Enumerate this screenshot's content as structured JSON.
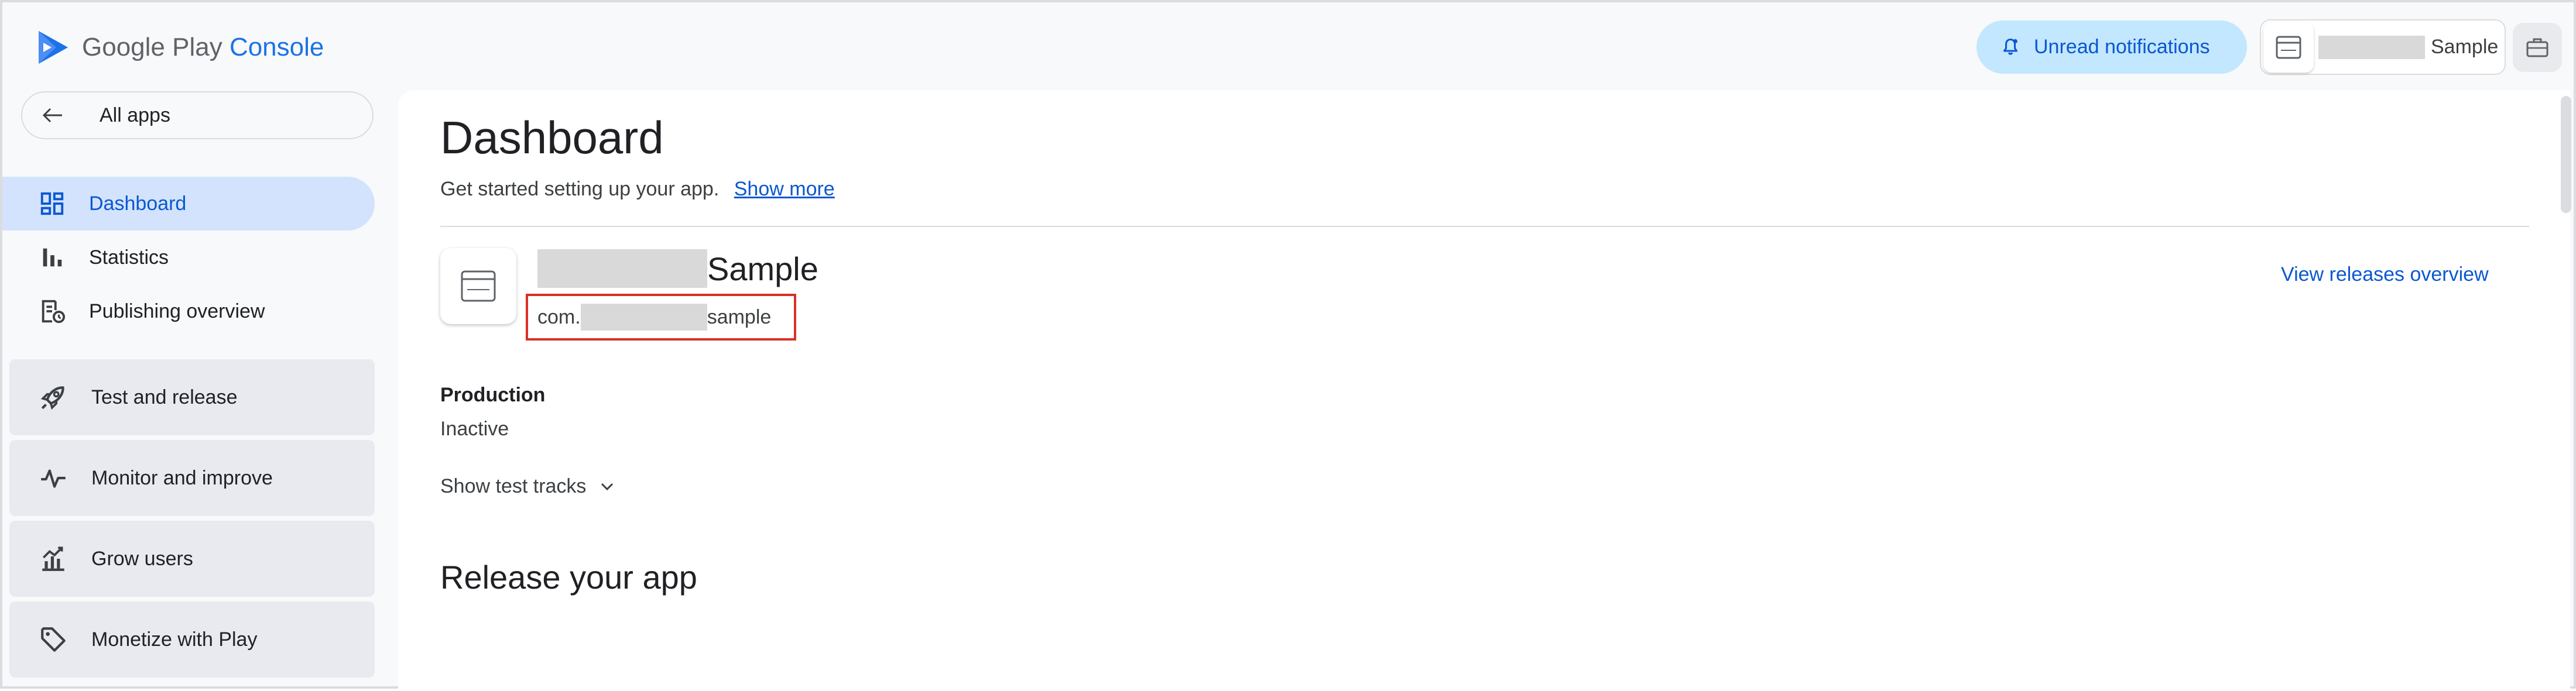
{
  "header": {
    "logo_text_main": "Google Play",
    "logo_text_accent": "Console",
    "notifications_label": "Unread notifications",
    "account_label": "Sample"
  },
  "sidebar": {
    "back_label": "All apps",
    "items": [
      {
        "label": "Dashboard",
        "icon": "dashboard-icon",
        "active": true
      },
      {
        "label": "Statistics",
        "icon": "bar-chart-icon"
      },
      {
        "label": "Publishing overview",
        "icon": "publishing-overview-icon"
      }
    ],
    "groups": [
      {
        "label": "Test and release",
        "icon": "rocket-icon"
      },
      {
        "label": "Monitor and improve",
        "icon": "vitals-icon"
      },
      {
        "label": "Grow users",
        "icon": "grow-users-icon"
      },
      {
        "label": "Monetize with Play",
        "icon": "tag-icon"
      }
    ]
  },
  "main": {
    "title": "Dashboard",
    "subtitle": "Get started setting up your app.",
    "show_more": "Show more",
    "app_name": "Sample",
    "package_prefix": "com.",
    "package_suffix": "sample",
    "view_releases": "View releases overview",
    "production_label": "Production",
    "production_status": "Inactive",
    "show_test_tracks": "Show test tracks",
    "release_section_title": "Release your app"
  },
  "colors": {
    "accent": "#0b57d0",
    "active_nav_bg": "#d3e3fd",
    "notification_bg": "#c2e7ff",
    "highlight_border": "#d93025",
    "group_bg": "#e8eaf0"
  }
}
